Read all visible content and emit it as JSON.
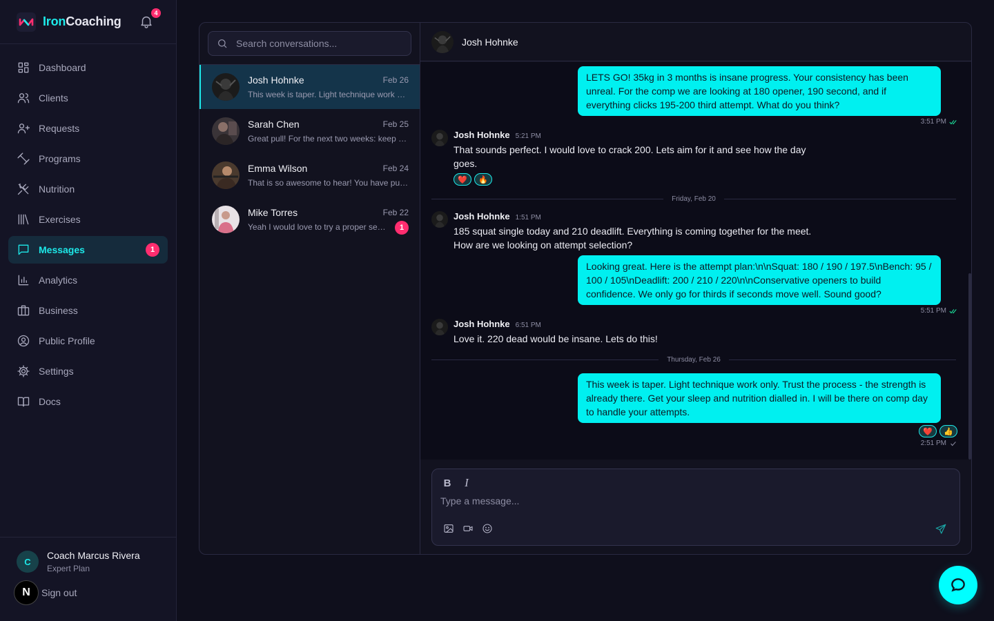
{
  "brand": {
    "name_part1": "Iron",
    "name_part2": "Coaching",
    "notifications_count": "4"
  },
  "nav": {
    "items": [
      {
        "label": "Dashboard",
        "icon": "dashboard-icon"
      },
      {
        "label": "Clients",
        "icon": "users-icon"
      },
      {
        "label": "Requests",
        "icon": "user-plus-icon"
      },
      {
        "label": "Programs",
        "icon": "dumbbell-icon"
      },
      {
        "label": "Nutrition",
        "icon": "utensils-icon"
      },
      {
        "label": "Exercises",
        "icon": "library-icon"
      },
      {
        "label": "Messages",
        "icon": "message-square-icon",
        "badge": "1",
        "active": true
      },
      {
        "label": "Analytics",
        "icon": "bar-chart-icon"
      },
      {
        "label": "Business",
        "icon": "briefcase-icon"
      },
      {
        "label": "Public Profile",
        "icon": "user-circle-icon"
      },
      {
        "label": "Settings",
        "icon": "gear-icon"
      },
      {
        "label": "Docs",
        "icon": "book-open-icon"
      }
    ]
  },
  "user": {
    "initial": "C",
    "name": "Coach Marcus Rivera",
    "plan": "Expert Plan",
    "signout_label": "Sign out",
    "signout_badge": "N"
  },
  "search": {
    "placeholder": "Search conversations..."
  },
  "conversations": [
    {
      "name": "Josh Hohnke",
      "date": "Feb 26",
      "preview": "This week is taper. Light technique work only. Trust the process",
      "active": true
    },
    {
      "name": "Sarah Chen",
      "date": "Feb 25",
      "preview": "Great pull! For the next two weeks: keep the volume moderate"
    },
    {
      "name": "Emma Wilson",
      "date": "Feb 24",
      "preview": "That is so awesome to hear! You have put in the work"
    },
    {
      "name": "Mike Torres",
      "date": "Feb 22",
      "preview": "Yeah I would love to try a proper session",
      "unread": "1"
    }
  ],
  "chat": {
    "contact_name": "Josh Hohnke",
    "messages": {
      "m1": {
        "text": "LETS GO! 35kg in 3 months is insane progress. Your consistency has been unreal. For the comp we are looking at 180 opener, 190 second, and if everything clicks 195-200 third attempt. What do you think?",
        "time": "3:51 PM"
      },
      "m2": {
        "sender": "Josh Hohnke",
        "time": "5:21 PM",
        "text": "That sounds perfect. I would love to crack 200. Lets aim for it and see how the day goes.",
        "reactions": [
          "❤️",
          "🔥"
        ]
      },
      "divider1": "Friday, Feb 20",
      "m3": {
        "sender": "Josh Hohnke",
        "time": "1:51 PM",
        "text": "185 squat single today and 210 deadlift. Everything is coming together for the meet. How are we looking on attempt selection?"
      },
      "m4": {
        "text": "Looking great. Here is the attempt plan:\\n\\nSquat: 180 / 190 / 197.5\\nBench: 95 / 100 / 105\\nDeadlift: 200 / 210 / 220\\n\\nConservative openers to build confidence. We only go for thirds if seconds move well. Sound good?",
        "time": "5:51 PM"
      },
      "m5": {
        "sender": "Josh Hohnke",
        "time": "6:51 PM",
        "text": "Love it. 220 dead would be insane. Lets do this!"
      },
      "divider2": "Thursday, Feb 26",
      "m6": {
        "text": "This week is taper. Light technique work only. Trust the process - the strength is already there. Get your sleep and nutrition dialled in. I will be there on comp day to handle your attempts.",
        "time": "2:51 PM",
        "reactions": [
          "❤️",
          "👍"
        ]
      }
    }
  },
  "composer": {
    "bold": "B",
    "italic": "I",
    "placeholder": "Type a message..."
  },
  "colors": {
    "accent": "#1de9e9",
    "badge": "#ff2d6f",
    "bubble": "#00f0f0"
  }
}
